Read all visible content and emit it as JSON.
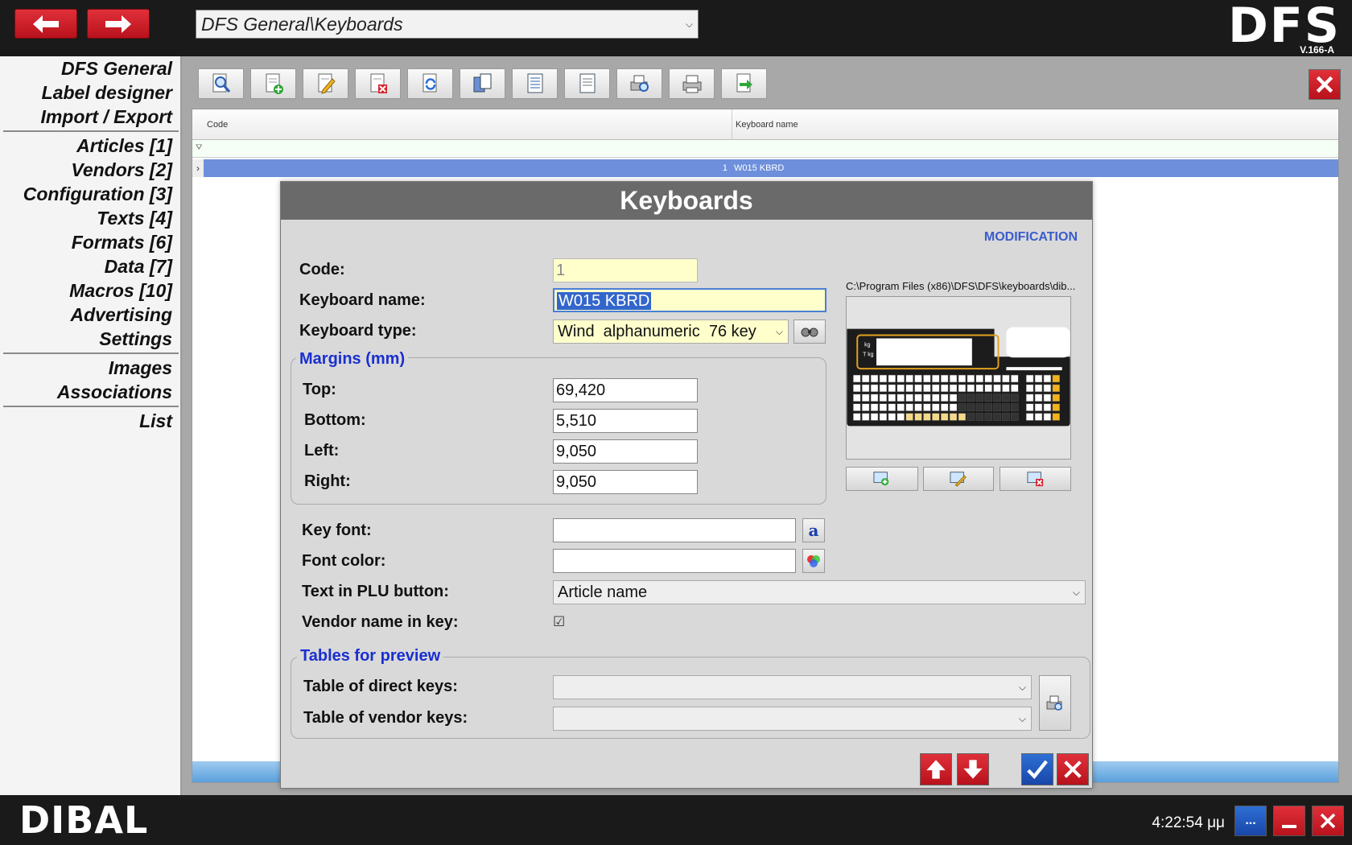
{
  "topbar": {
    "back_icon": "arrow-left-icon",
    "forward_icon": "arrow-right-icon",
    "path": "DFS General\\Keyboards",
    "logo": "DFS",
    "version": "V.166-A"
  },
  "sidebar": {
    "items": [
      "DFS General",
      "Label designer",
      "Import / Export",
      "Articles [1]",
      "Vendors [2]",
      "Configuration [3]",
      "Texts [4]",
      "Formats [6]",
      "Data [7]",
      "Macros [10]",
      "Advertising",
      "Settings",
      "Images",
      "Associations",
      "List"
    ]
  },
  "toolbar": {
    "icons": [
      "search-icon",
      "new-record-icon",
      "edit-icon",
      "delete-icon",
      "refresh-icon",
      "copy-icon",
      "list-icon",
      "document-icon",
      "print-preview-icon",
      "print-icon",
      "export-icon"
    ]
  },
  "grid": {
    "columns": [
      "Code",
      "Keyboard name"
    ],
    "rows": [
      {
        "code": "1",
        "name": "W015 KBRD"
      }
    ]
  },
  "dialog": {
    "title": "Keyboards",
    "mode": "MODIFICATION",
    "code_label": "Code:",
    "code_value": "1",
    "name_label": "Keyboard name:",
    "name_value": "W015 KBRD",
    "type_label": "Keyboard type:",
    "type_value": "Wind  alphanumeric  76 key",
    "margins_title": "Margins (mm)",
    "top_label": "Top:",
    "top_value": "69,420",
    "bottom_label": "Bottom:",
    "bottom_value": "5,510",
    "left_label": "Left:",
    "left_value": "9,050",
    "right_label": "Right:",
    "right_value": "9,050",
    "key_font_label": "Key font:",
    "key_font_value": "",
    "font_color_label": "Font color:",
    "font_color_value": "",
    "plu_label": "Text in PLU button:",
    "plu_value": "Article name",
    "vendor_label": "Vendor name in key:",
    "vendor_checked": "☑",
    "preview_title": "Tables for preview",
    "direct_label": "Table of direct keys:",
    "direct_value": "",
    "vendor_keys_label": "Table of vendor keys:",
    "vendor_keys_value": "",
    "image_path": "C:\\Program Files (x86)\\DFS\\DFS\\keyboards\\dib...",
    "keypad_kg": "kg",
    "keypad_tkg": "T kg"
  },
  "bottombar": {
    "brand": "DIBAL",
    "clock": "4:22:54 μμ",
    "menu_label": "..."
  },
  "colors": {
    "accent_red": "#c81e28",
    "selection_blue": "#6d8fdc",
    "group_title": "#1a2fd0",
    "mode": "#3b5ccc"
  }
}
